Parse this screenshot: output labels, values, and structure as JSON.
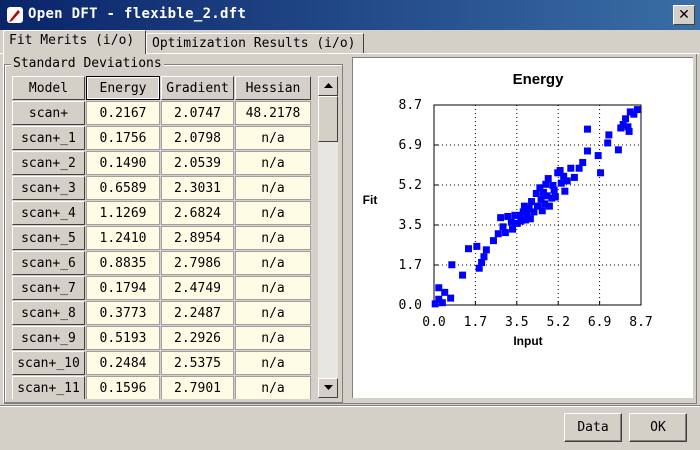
{
  "window": {
    "title": "Open DFT - flexible_2.dft",
    "close_glyph": "✕",
    "icon": "pen-icon"
  },
  "tabs": [
    {
      "label": "Fit Merits (i/o)",
      "active": true
    },
    {
      "label": "Optimization Results (i/o)",
      "active": false
    }
  ],
  "group": {
    "label": "Standard Deviations"
  },
  "table": {
    "headers": [
      "Model",
      "Energy",
      "Gradient",
      "Hessian"
    ],
    "selected_header": "Energy",
    "rows": [
      [
        "scan+",
        "0.2167",
        "2.0747",
        "48.2178"
      ],
      [
        "scan+_1",
        "0.1756",
        "2.0798",
        "n/a"
      ],
      [
        "scan+_2",
        "0.1490",
        "2.0539",
        "n/a"
      ],
      [
        "scan+_3",
        "0.6589",
        "2.3031",
        "n/a"
      ],
      [
        "scan+_4",
        "1.1269",
        "2.6824",
        "n/a"
      ],
      [
        "scan+_5",
        "1.2410",
        "2.8954",
        "n/a"
      ],
      [
        "scan+_6",
        "0.8835",
        "2.7986",
        "n/a"
      ],
      [
        "scan+_7",
        "0.1794",
        "2.4749",
        "n/a"
      ],
      [
        "scan+_8",
        "0.3773",
        "2.2487",
        "n/a"
      ],
      [
        "scan+_9",
        "0.5193",
        "2.2926",
        "n/a"
      ],
      [
        "scan+_10",
        "0.2484",
        "2.5375",
        "n/a"
      ],
      [
        "scan+_11",
        "0.1596",
        "2.7901",
        "n/a"
      ]
    ]
  },
  "scrollbar": {
    "up_icon": "scroll-up-icon",
    "down_icon": "scroll-down-icon"
  },
  "chart_data": {
    "type": "scatter",
    "title": "Energy",
    "xlabel": "Input",
    "ylabel": "Fit",
    "xlim": [
      0,
      8.7
    ],
    "ylim": [
      0,
      8.7
    ],
    "xticks": [
      "0.0",
      "1.7",
      "3.5",
      "5.2",
      "6.9",
      "8.7"
    ],
    "yticks": [
      "0.0",
      "1.7",
      "3.5",
      "5.2",
      "6.9",
      "8.7"
    ],
    "grid": true,
    "marker_color": "#0000ff",
    "points": [
      [
        0.05,
        0.05
      ],
      [
        0.2,
        0.25
      ],
      [
        0.2,
        0.75
      ],
      [
        0.35,
        0.1
      ],
      [
        0.7,
        0.3
      ],
      [
        0.45,
        0.55
      ],
      [
        0.75,
        1.75
      ],
      [
        1.2,
        1.3
      ],
      [
        1.45,
        2.45
      ],
      [
        1.8,
        2.55
      ],
      [
        1.9,
        1.6
      ],
      [
        2.0,
        1.85
      ],
      [
        2.1,
        2.1
      ],
      [
        2.2,
        2.4
      ],
      [
        2.5,
        2.8
      ],
      [
        2.7,
        3.1
      ],
      [
        2.8,
        3.8
      ],
      [
        2.9,
        3.4
      ],
      [
        3.0,
        3.15
      ],
      [
        3.1,
        3.85
      ],
      [
        3.25,
        3.6
      ],
      [
        3.3,
        3.3
      ],
      [
        3.4,
        3.9
      ],
      [
        3.5,
        3.55
      ],
      [
        3.6,
        3.9
      ],
      [
        3.65,
        3.65
      ],
      [
        3.75,
        4.05
      ],
      [
        3.8,
        4.3
      ],
      [
        3.85,
        3.7
      ],
      [
        3.9,
        3.95
      ],
      [
        4.0,
        4.2
      ],
      [
        4.05,
        3.75
      ],
      [
        4.1,
        4.5
      ],
      [
        4.2,
        4.05
      ],
      [
        4.3,
        4.85
      ],
      [
        4.35,
        4.3
      ],
      [
        4.45,
        5.1
      ],
      [
        4.5,
        4.6
      ],
      [
        4.55,
        4.1
      ],
      [
        4.6,
        4.9
      ],
      [
        4.65,
        4.4
      ],
      [
        4.7,
        5.25
      ],
      [
        4.75,
        4.75
      ],
      [
        4.8,
        5.5
      ],
      [
        4.85,
        4.3
      ],
      [
        4.95,
        4.65
      ],
      [
        5.0,
        5.2
      ],
      [
        5.05,
        5.0
      ],
      [
        5.1,
        4.7
      ],
      [
        5.2,
        5.75
      ],
      [
        5.3,
        5.85
      ],
      [
        5.35,
        5.3
      ],
      [
        5.45,
        5.6
      ],
      [
        5.5,
        4.95
      ],
      [
        5.6,
        5.4
      ],
      [
        5.75,
        5.95
      ],
      [
        5.9,
        5.55
      ],
      [
        6.1,
        5.95
      ],
      [
        6.25,
        6.2
      ],
      [
        6.45,
        6.7
      ],
      [
        6.9,
        6.5
      ],
      [
        7.0,
        5.75
      ],
      [
        7.3,
        7.05
      ],
      [
        7.35,
        7.4
      ],
      [
        7.75,
        6.75
      ],
      [
        7.85,
        7.7
      ],
      [
        7.95,
        7.85
      ],
      [
        8.05,
        8.1
      ],
      [
        8.15,
        7.75
      ],
      [
        8.2,
        7.55
      ],
      [
        8.25,
        8.4
      ],
      [
        8.4,
        8.3
      ],
      [
        8.55,
        8.5
      ],
      [
        6.45,
        7.65
      ]
    ]
  },
  "buttons": {
    "data": "Data",
    "ok": "OK"
  }
}
